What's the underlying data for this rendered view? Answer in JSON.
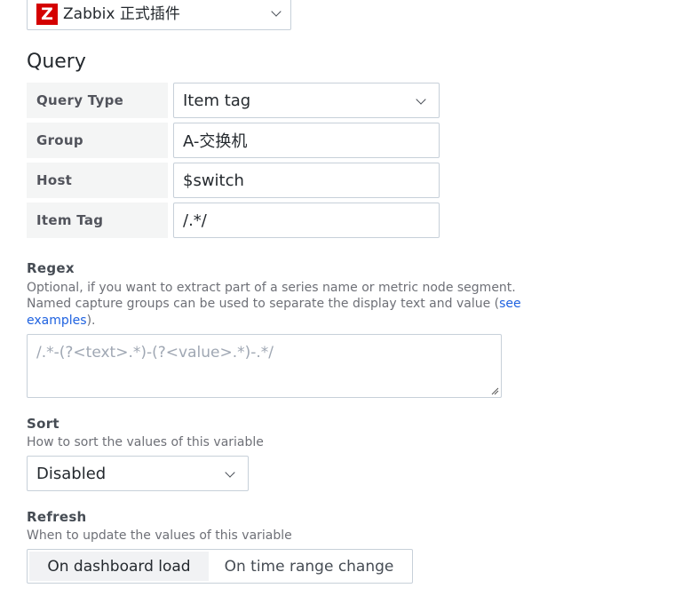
{
  "datasource": {
    "logo_letter": "Z",
    "logo_color": "#d40000",
    "name": "Zabbix 正式插件",
    "icon": "chevron-down-icon"
  },
  "query_section": {
    "title": "Query",
    "rows": [
      {
        "label": "Query Type",
        "value": "Item tag",
        "kind": "select"
      },
      {
        "label": "Group",
        "value": "A-交换机",
        "kind": "input"
      },
      {
        "label": "Host",
        "value": "$switch",
        "kind": "input"
      },
      {
        "label": "Item Tag",
        "value": "/.*/",
        "kind": "input"
      }
    ]
  },
  "regex": {
    "label": "Regex",
    "description_line1": "Optional, if you want to extract part of a series name or metric node segment.",
    "description_line2_prefix": "Named capture groups can be used to separate the display text and value (",
    "link_part1": "see",
    "link_part2": "examples",
    "description_suffix": ").",
    "placeholder": "/.*-(?<text>.*)-(?<value>.*)-.*/"
  },
  "sort": {
    "label": "Sort",
    "description": "How to sort the values of this variable",
    "value": "Disabled"
  },
  "refresh": {
    "label": "Refresh",
    "description": "When to update the values of this variable",
    "options": [
      "On dashboard load",
      "On time range change"
    ],
    "selected": "On dashboard load"
  },
  "colors": {
    "link": "#1f62e0",
    "border": "#c7d0d9",
    "label_bg": "#f4f5f5"
  }
}
